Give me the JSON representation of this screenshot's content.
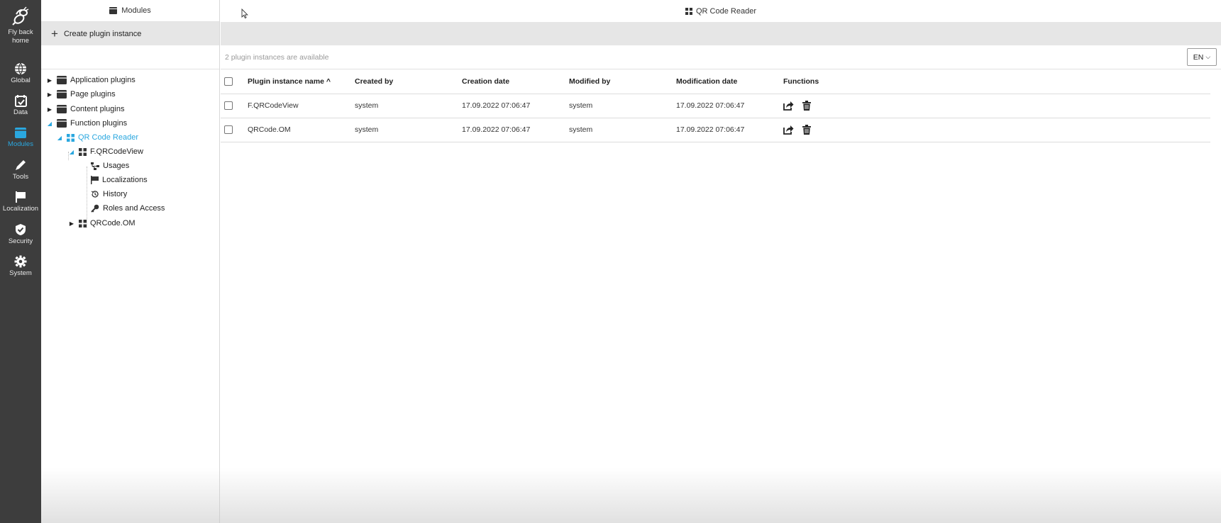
{
  "rail": {
    "home": "Fly back home",
    "items": [
      {
        "label": "Global",
        "icon": "globe-icon"
      },
      {
        "label": "Data",
        "icon": "calendar-check-icon"
      },
      {
        "label": "Modules",
        "icon": "window-icon"
      },
      {
        "label": "Tools",
        "icon": "pencil-icon"
      },
      {
        "label": "Localization",
        "icon": "flag-icon"
      },
      {
        "label": "Security",
        "icon": "shield-check-icon"
      },
      {
        "label": "System",
        "icon": "gear-icon"
      }
    ],
    "active_color": "#2aa7df"
  },
  "panel": {
    "title": "Modules",
    "create_label": "Create plugin instance",
    "tree": [
      {
        "label": "Application plugins"
      },
      {
        "label": "Page plugins"
      },
      {
        "label": "Content plugins"
      },
      {
        "label": "Function plugins"
      },
      {
        "label": "QR Code Reader"
      },
      {
        "label": "F.QRCodeView"
      },
      {
        "label": "Usages"
      },
      {
        "label": "Localizations"
      },
      {
        "label": "History"
      },
      {
        "label": "Roles and Access"
      },
      {
        "label": "QRCode.OM"
      }
    ]
  },
  "main": {
    "title": "QR Code Reader",
    "count_text": "2 plugin instances are available",
    "language": "EN",
    "columns": [
      "Plugin instance name ^",
      "Created by",
      "Creation date",
      "Modified by",
      "Modification date",
      "Functions"
    ],
    "rows": [
      {
        "name": "F.QRCodeView",
        "created_by": "system",
        "creation_date": "17.09.2022 07:06:47",
        "modified_by": "system",
        "modification_date": "17.09.2022 07:06:47"
      },
      {
        "name": "QRCode.OM",
        "created_by": "system",
        "creation_date": "17.09.2022 07:06:47",
        "modified_by": "system",
        "modification_date": "17.09.2022 07:06:47"
      }
    ]
  }
}
